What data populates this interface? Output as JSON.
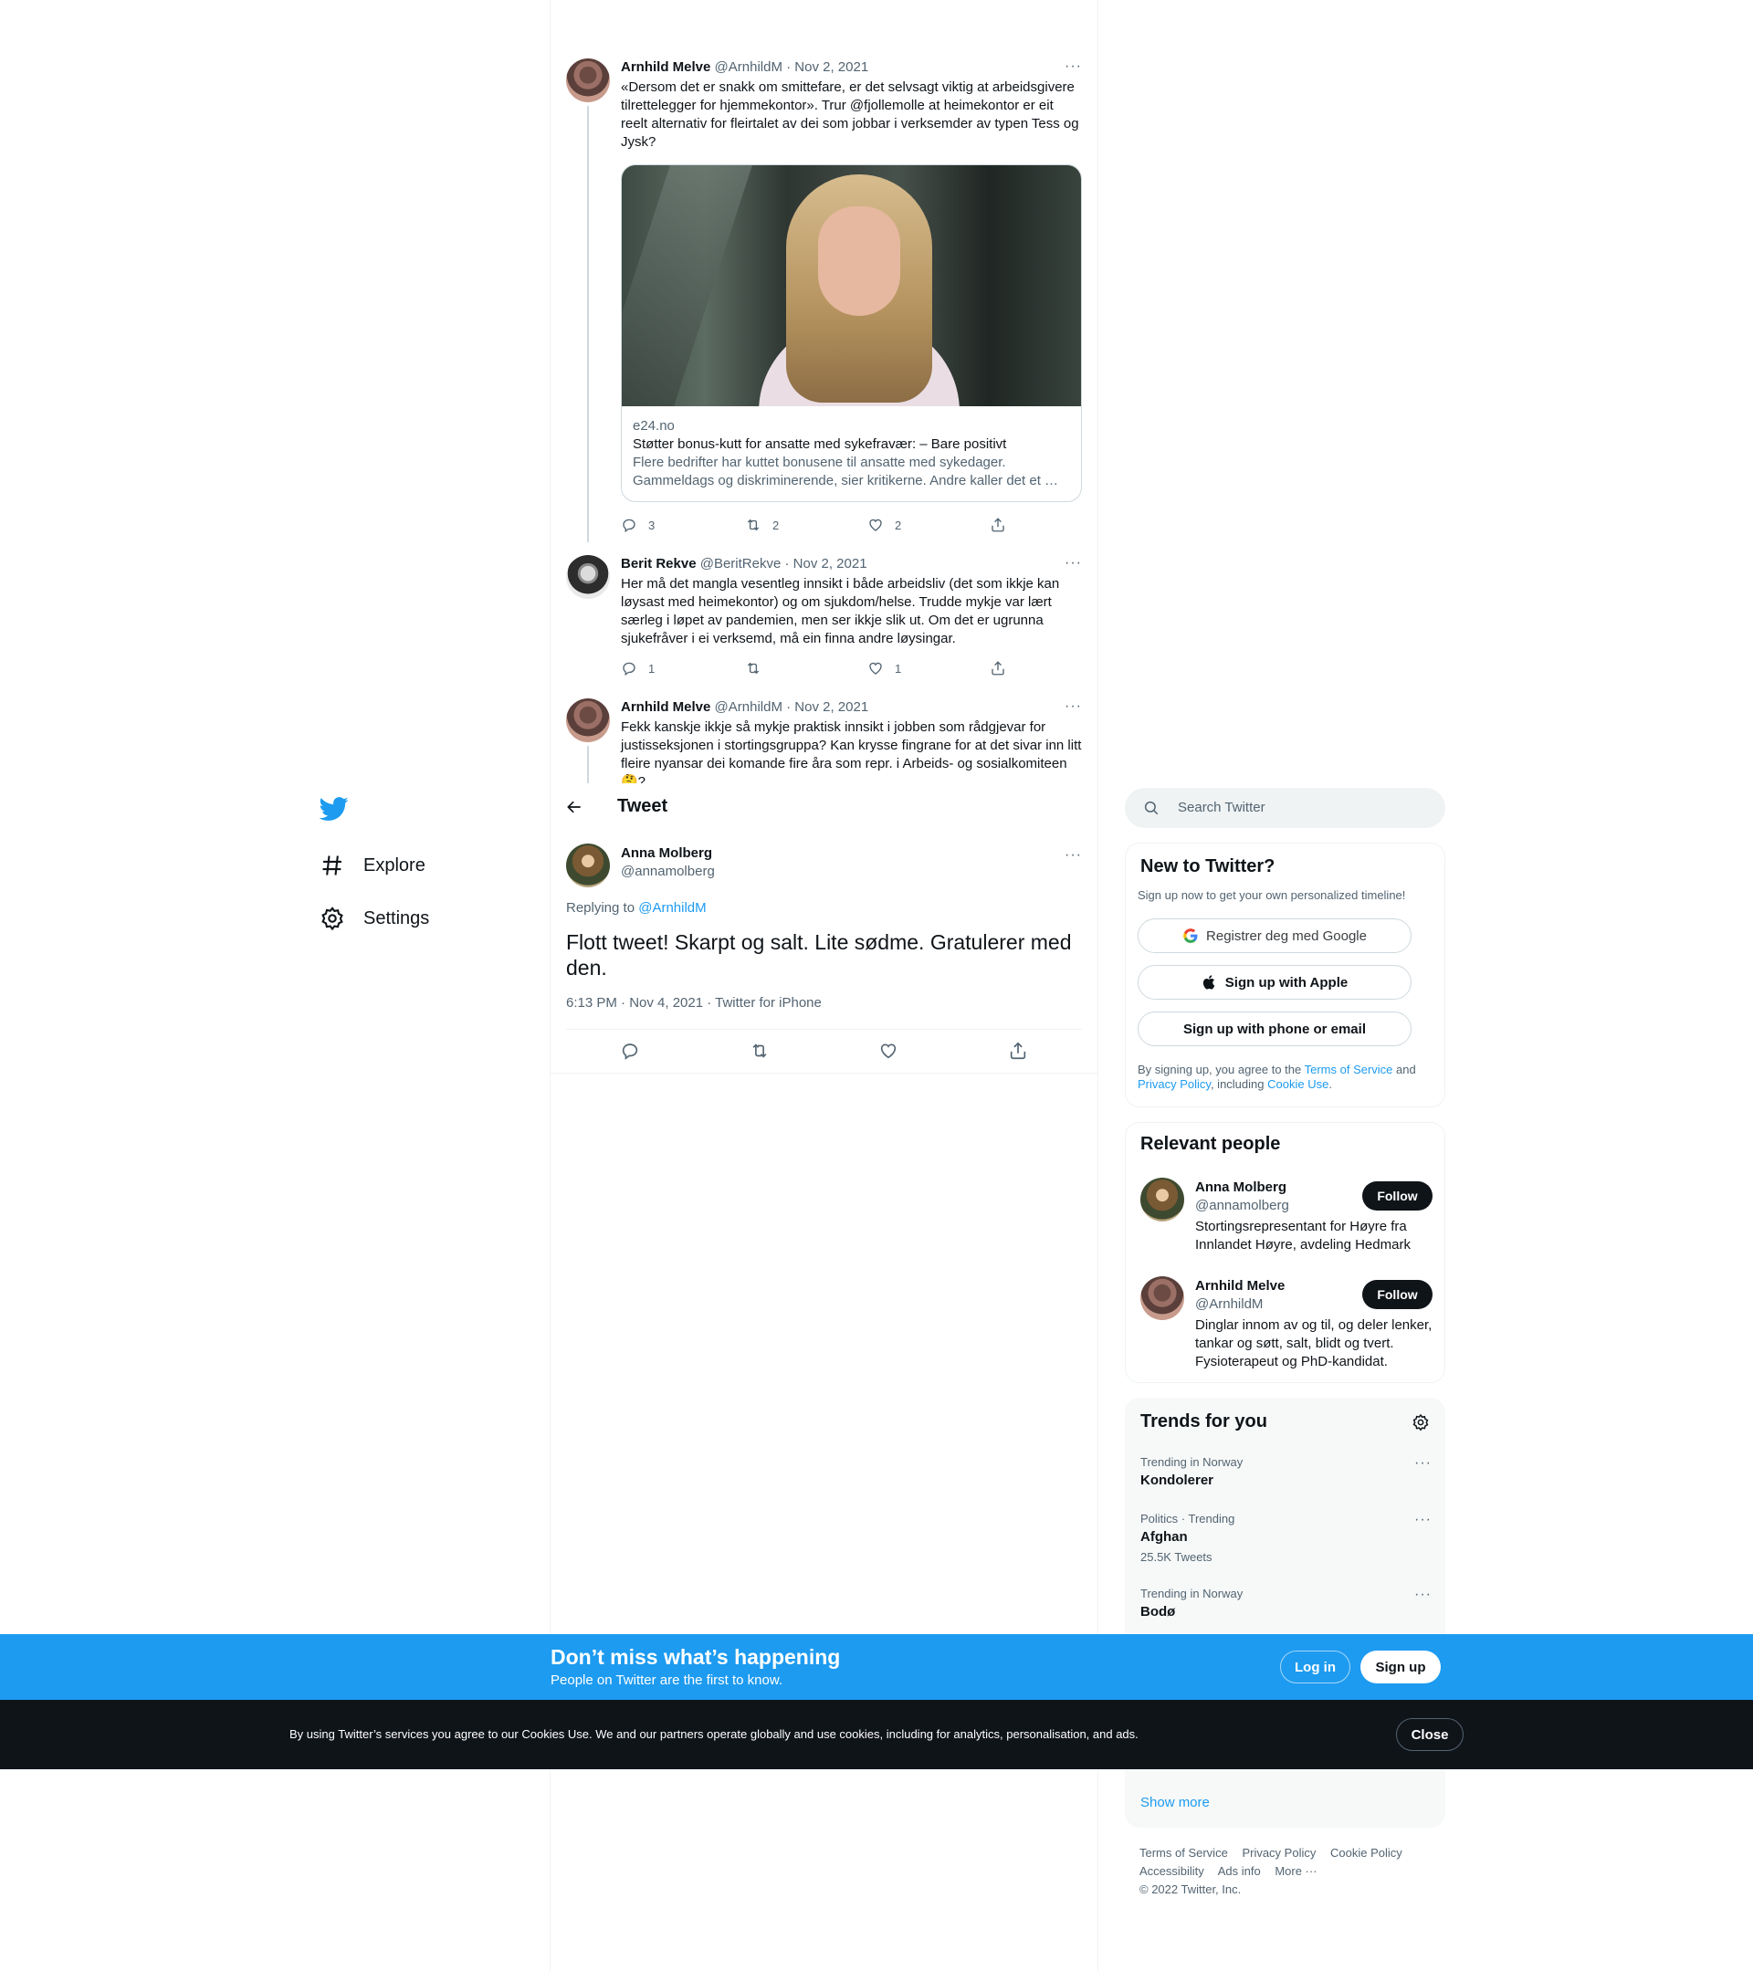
{
  "nav": {
    "items": [
      {
        "label": "Explore",
        "icon": "hashtag-icon"
      },
      {
        "label": "Settings",
        "icon": "gear-icon"
      }
    ]
  },
  "header": {
    "title": "Tweet"
  },
  "thread": [
    {
      "name": "Arnhild Melve",
      "handle": "@ArnhildM",
      "date": "· Nov 2, 2021",
      "text": "«Dersom det er snakk om smittefare, er det selvsagt viktig at arbeidsgivere tilrettelegger for hjemmekontor». Trur @fjollemolle at heimekontor er eit reelt alternativ for fleirtalet av dei som jobbar i verksemder av typen Tess og Jysk?",
      "card": {
        "domain": "e24.no",
        "title": "Støtter bonus-kutt for ansatte med sykefravær: – Bare positivt",
        "description": "Flere bedrifter har kuttet bonusene til ansatte med sykedager. Gammeldags og diskriminerende, sier kritikerne. Andre kaller det et …"
      },
      "replies": "3",
      "retweets": "2",
      "likes": "2"
    },
    {
      "name": "Berit Rekve",
      "handle": "@BeritRekve",
      "date": "· Nov 2, 2021",
      "text": "Her må det mangla vesentleg innsikt i både arbeidsliv (det som ikkje kan løysast med heimekontor) og om sjukdom/helse. Trudde mykje var lært særleg i løpet av pandemien, men ser ikkje slik ut. Om det er ugrunna sjukefråver i ei verksemd, må ein finna andre løysingar.",
      "replies": "1",
      "retweets": "",
      "likes": "1"
    },
    {
      "name": "Arnhild Melve",
      "handle": "@ArnhildM",
      "date": "· Nov 2, 2021",
      "text": "Fekk kanskje ikkje så mykje praktisk innsikt i jobben som rådgjevar for justisseksjonen i stortingsgruppa? Kan krysse fingrane for at det sivar inn litt fleire nyansar dei komande fire åra som repr. i Arbeids- og sosialkomiteen 🤔?"
    }
  ],
  "focal": {
    "name": "Anna Molberg",
    "handle": "@annamolberg",
    "replying_prefix": "Replying to ",
    "replying_to": "@ArnhildM",
    "text": "Flott tweet! Skarpt og salt. Lite sødme. Gratulerer med den.",
    "meta": "6:13 PM · Nov 4, 2021 · Twitter for iPhone"
  },
  "search": {
    "placeholder": "Search Twitter"
  },
  "new_to_twitter": {
    "title": "New to Twitter?",
    "subtitle": "Sign up now to get your own personalized timeline!",
    "google": "Registrer deg med Google",
    "apple": "Sign up with Apple",
    "phone": "Sign up with phone or email",
    "legal_1": "By signing up, you agree to the ",
    "terms": "Terms of Service",
    "legal_2": " and ",
    "privacy": "Privacy Policy",
    "legal_3": ", including ",
    "cookie": "Cookie Use",
    "legal_4": "."
  },
  "relevant": {
    "title": "Relevant people",
    "people": [
      {
        "name": "Anna Molberg",
        "handle": "@annamolberg",
        "bio": "Stortingsrepresentant for Høyre fra Innlandet Høyre, avdeling Hedmark",
        "button": "Follow"
      },
      {
        "name": "Arnhild Melve",
        "handle": "@ArnhildM",
        "bio": "Dinglar innom av og til, og deler lenker, tankar og søtt, salt, blidt og tvert. Fysioterapeut og PhD-kandidat.",
        "button": "Follow"
      }
    ]
  },
  "trends": {
    "title": "Trends for you",
    "items": [
      {
        "context": "Trending in Norway",
        "name": "Kondolerer",
        "count": ""
      },
      {
        "context": "Politics · Trending",
        "name": "Afghan",
        "count": "25.5K Tweets"
      },
      {
        "context": "Trending in Norway",
        "name": "Bodø",
        "count": ""
      }
    ],
    "show_more": "Show more"
  },
  "footer": {
    "links": [
      "Terms of Service",
      "Privacy Policy",
      "Cookie Policy",
      "Accessibility",
      "Ads info",
      "More ···"
    ],
    "copyright": "© 2022 Twitter, Inc."
  },
  "banner": {
    "title": "Don’t miss what’s happening",
    "subtitle": "People on Twitter are the first to know.",
    "login": "Log in",
    "signup": "Sign up"
  },
  "cookie_banner": {
    "text": "By using Twitter’s services you agree to our Cookies Use. We and our partners operate globally and use cookies, including for analytics, personalisation, and ads.",
    "close": "Close"
  },
  "colors": {
    "accent": "#1d9bf0",
    "text": "#0f1419",
    "muted": "#536471",
    "dark_banner": "#0f1419"
  }
}
